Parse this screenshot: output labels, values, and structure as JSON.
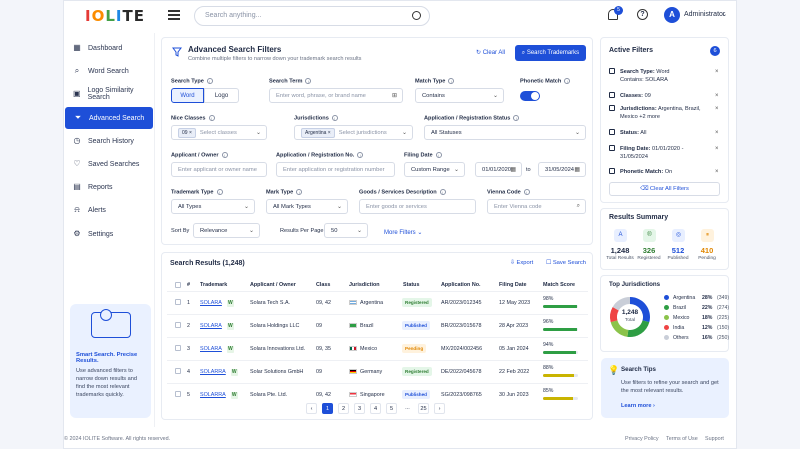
{
  "app": {
    "logo": "IOLITE",
    "search_placeholder": "Search anything...",
    "notif_count": "5",
    "user_initial": "A",
    "user_name": "Administrator"
  },
  "sidebar": {
    "items": [
      {
        "label": "Dashboard",
        "icon": "grid-icon"
      },
      {
        "label": "Word Search",
        "icon": "search-icon"
      },
      {
        "label": "Logo Similarity Search",
        "icon": "image-icon"
      },
      {
        "label": "Advanced Search",
        "icon": "filter-icon"
      },
      {
        "label": "Search History",
        "icon": "clock-icon"
      },
      {
        "label": "Saved Searches",
        "icon": "heart-icon"
      },
      {
        "label": "Reports",
        "icon": "report-icon"
      },
      {
        "label": "Alerts",
        "icon": "bell-icon"
      },
      {
        "label": "Settings",
        "icon": "gear-icon"
      }
    ],
    "promo_title": "Smart Search. Precise Results.",
    "promo_text": "Use advanced filters to narrow down results and find the most relevant trademarks quickly."
  },
  "filters": {
    "title": "Advanced Search Filters",
    "subtitle": "Combine multiple filters to narrow down your trademark search results",
    "clear_all": "Clear All",
    "search_button": "Search Trademarks",
    "search_type_label": "Search Type",
    "search_type_word": "Word",
    "search_type_logo": "Logo",
    "search_term_label": "Search Term",
    "search_term_placeholder": "Enter word, phrase, or brand name",
    "match_type_label": "Match Type",
    "match_type_value": "Contains",
    "phonetic_label": "Phonetic Match",
    "nice_label": "Nice Classes",
    "nice_chip": "09",
    "nice_placeholder": "Select classes",
    "jur_label": "Jurisdictions",
    "jur_chip": "Argentina",
    "jur_placeholder": "Select jurisdictions",
    "status_label": "Application / Registration Status",
    "status_value": "All Statuses",
    "applicant_label": "Applicant / Owner",
    "applicant_placeholder": "Enter applicant or owner name",
    "appno_label": "Application / Registration No.",
    "appno_placeholder": "Enter application or registration number",
    "filing_label": "Filing Date",
    "filing_range": "Custom Range",
    "date_from": "01/01/2020",
    "date_to_word": "to",
    "date_to": "31/05/2024",
    "tm_type_label": "Trademark Type",
    "tm_type_value": "All Types",
    "mark_type_label": "Mark Type",
    "mark_type_value": "All Mark Types",
    "goods_label": "Goods / Services Description",
    "goods_placeholder": "Enter goods or services",
    "vienna_label": "Vienna Code",
    "vienna_placeholder": "Enter Vienna code",
    "sort_label": "Sort By",
    "sort_value": "Relevance",
    "rpp_label": "Results Per Page",
    "rpp_value": "50",
    "more_filters": "More Filters"
  },
  "results": {
    "title": "Search Results (1,248)",
    "export": "Export",
    "save": "Save Search",
    "headers": [
      "#",
      "Trademark",
      "Applicant / Owner",
      "Class",
      "Jurisdiction",
      "Status",
      "Application No.",
      "Filing Date",
      "Match Score"
    ],
    "rows": [
      {
        "n": "1",
        "tm": "SOLARA",
        "owner": "Solara Tech S.A.",
        "cls": "09, 42",
        "jur": "Argentina",
        "status": "Registered",
        "app": "AR/2023/012345",
        "date": "12 May 2023",
        "score": "98%",
        "pct": 98
      },
      {
        "n": "2",
        "tm": "SOLARA",
        "owner": "Solara Holdings LLC",
        "cls": "09",
        "jur": "Brazil",
        "status": "Published",
        "app": "BR/2023/015678",
        "date": "28 Apr 2023",
        "score": "96%",
        "pct": 96
      },
      {
        "n": "3",
        "tm": "SOLARA",
        "owner": "Solara Innovations Ltd.",
        "cls": "09, 35",
        "jur": "Mexico",
        "status": "Pending",
        "app": "MX/2024/002456",
        "date": "05 Jan 2024",
        "score": "94%",
        "pct": 94
      },
      {
        "n": "4",
        "tm": "SOLARRA",
        "owner": "Solar Solutions GmbH",
        "cls": "09",
        "jur": "Germany",
        "status": "Registered",
        "app": "DE/2022/045678",
        "date": "22 Feb 2022",
        "score": "88%",
        "pct": 88
      },
      {
        "n": "5",
        "tm": "SOLARRA",
        "owner": "Solara Pte. Ltd.",
        "cls": "09, 42",
        "jur": "Singapore",
        "status": "Published",
        "app": "SG/2023/098765",
        "date": "30 Jun 2023",
        "score": "85%",
        "pct": 85
      }
    ],
    "pages": [
      "‹",
      "1",
      "2",
      "3",
      "4",
      "5",
      "...",
      "25",
      "›"
    ]
  },
  "active_filters": {
    "title": "Active Filters",
    "count": "6",
    "items": [
      {
        "label": "Search Type:",
        "value": "Word",
        "line2": "Contains: SOLARA"
      },
      {
        "label": "Classes:",
        "value": "09",
        "line2": ""
      },
      {
        "label": "Jurisdictions:",
        "value": "Argentina, Brazil,",
        "line2": "Mexico  +2 more"
      },
      {
        "label": "Status:",
        "value": "All",
        "line2": ""
      },
      {
        "label": "Filing Date:",
        "value": "01/01/2020 -",
        "line2": "31/05/2024"
      },
      {
        "label": "Phonetic Match:",
        "value": "On",
        "line2": ""
      }
    ],
    "clear_btn": "Clear All Filters"
  },
  "summary": {
    "title": "Results Summary",
    "stats": [
      {
        "num": "1,248",
        "label": "Total Results",
        "color": "#1e4fd8",
        "bg": "#e8efff"
      },
      {
        "num": "326",
        "label": "Registered",
        "color": "#2e7d32",
        "bg": "#e4f6e8"
      },
      {
        "num": "512",
        "label": "Published",
        "color": "#1e4fd8",
        "bg": "#e8efff"
      },
      {
        "num": "410",
        "label": "Pending",
        "color": "#e08600",
        "bg": "#fff2dd"
      }
    ]
  },
  "chart_data": {
    "type": "pie",
    "title": "Top Jurisdictions",
    "center_value": "1,248",
    "center_label": "Total",
    "slices": [
      {
        "name": "Argentina",
        "pct": "28%",
        "count": "(349)",
        "value": 28,
        "color": "#1e4fd8"
      },
      {
        "name": "Brazil",
        "pct": "22%",
        "count": "(274)",
        "value": 22,
        "color": "#2e9e44"
      },
      {
        "name": "Mexico",
        "pct": "18%",
        "count": "(225)",
        "value": 18,
        "color": "#8bc34a"
      },
      {
        "name": "India",
        "pct": "12%",
        "count": "(150)",
        "value": 12,
        "color": "#ef4444"
      },
      {
        "name": "Others",
        "pct": "16%",
        "count": "(250)",
        "value": 16,
        "color": "#c9ced8"
      }
    ]
  },
  "tips": {
    "title": "Search Tips",
    "text": "Use filters to refine your search and get the most relevant results.",
    "link": "Learn more  ›"
  },
  "footer": {
    "copyright": "© 2024 IOLITE Software. All rights reserved.",
    "links": [
      "Privacy Policy",
      "Terms of Use",
      "Support"
    ]
  }
}
